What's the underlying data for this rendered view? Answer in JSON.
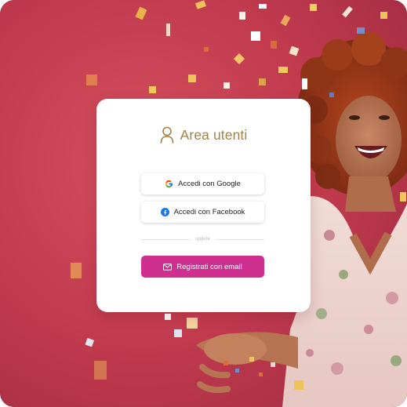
{
  "login_card": {
    "title": "Area utenti",
    "google_button_label": "Accedi con Google",
    "facebook_button_label": "Accedi con Facebook",
    "divider_text": "oppure",
    "email_button_label": "Registrati con email"
  },
  "colors": {
    "background_red": "#c43b50",
    "title_gold": "#a08344",
    "email_button_magenta": "#cf2f8f",
    "facebook_blue": "#1877f2"
  },
  "icons": {
    "title": "user-icon",
    "google": "google-logo-icon",
    "facebook": "facebook-logo-icon",
    "email": "envelope-icon"
  }
}
